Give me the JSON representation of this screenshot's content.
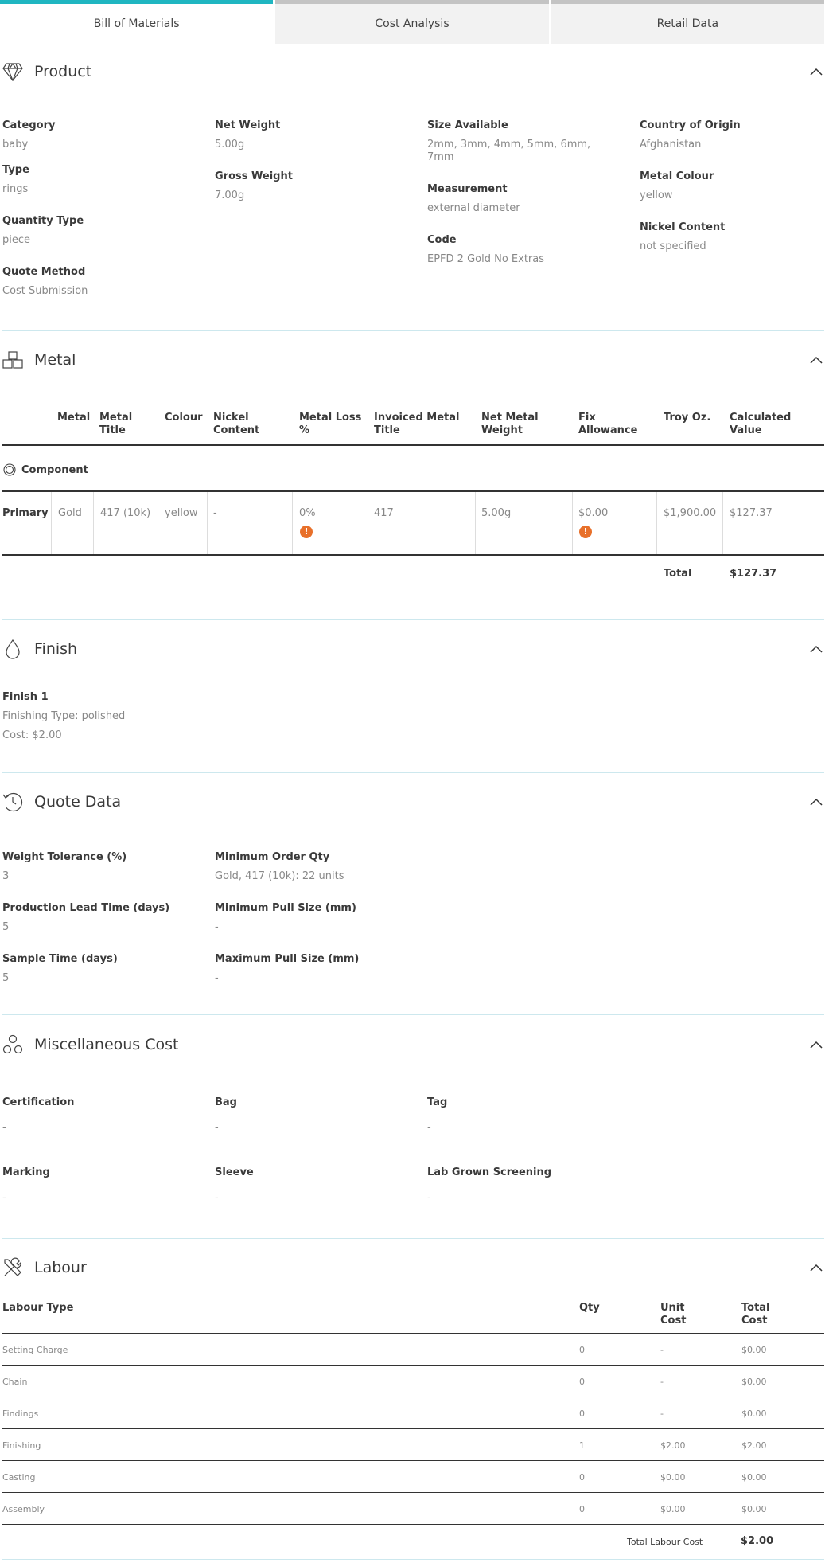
{
  "tabs": [
    {
      "label": "Bill of Materials",
      "active": true
    },
    {
      "label": "Cost Analysis",
      "active": false
    },
    {
      "label": "Retail Data",
      "active": false
    }
  ],
  "product": {
    "title": "Product",
    "category_label": "Category",
    "category": "baby",
    "type_label": "Type",
    "type": "rings",
    "quantity_type_label": "Quantity Type",
    "quantity_type": "piece",
    "quote_method_label": "Quote Method",
    "quote_method": "Cost Submission",
    "net_weight_label": "Net Weight",
    "net_weight": "5.00g",
    "gross_weight_label": "Gross Weight",
    "gross_weight": "7.00g",
    "size_label": "Size Available",
    "size_line1": "2mm, 3mm, 4mm, 5mm, 6mm,",
    "size_line2": "7mm",
    "measurement_label": "Measurement",
    "measurement": "external diameter",
    "code_label": "Code",
    "code": "EPFD 2 Gold No Extras",
    "origin_label": "Country of Origin",
    "origin": "Afghanistan",
    "metal_colour_label": "Metal Colour",
    "metal_colour": "yellow",
    "nickel_label": "Nickel Content",
    "nickel": "not specified"
  },
  "metal": {
    "title": "Metal",
    "headers": {
      "metal": "Metal",
      "metal_title_1": "Metal",
      "metal_title_2": "Title",
      "colour": "Colour",
      "nickel_1": "Nickel",
      "nickel_2": "Content",
      "loss_1": "Metal Loss",
      "loss_2": "%",
      "invoiced_1": "Invoiced Metal",
      "invoiced_2": "Title",
      "net_1": "Net Metal",
      "net_2": "Weight",
      "fix_1": "Fix",
      "fix_2": "Allowance",
      "troy": "Troy Oz.",
      "calc_1": "Calculated",
      "calc_2": "Value"
    },
    "component_label": "Component",
    "row": {
      "name": "Primary",
      "metal": "Gold",
      "title": "417 (10k)",
      "colour": "yellow",
      "nickel": "-",
      "loss": "0%",
      "invoiced": "417",
      "net": "5.00g",
      "fix": "$0.00",
      "troy": "$1,900.00",
      "value": "$127.37"
    },
    "warn_glyph": "!",
    "total_label": "Total",
    "total": "$127.37"
  },
  "finish": {
    "title": "Finish",
    "name": "Finish 1",
    "type": "Finishing Type: polished",
    "cost": "Cost: $2.00"
  },
  "quote": {
    "title": "Quote Data",
    "tolerance_label": "Weight Tolerance (%)",
    "tolerance": "3",
    "lead_label": "Production Lead Time (days)",
    "lead": "5",
    "sample_label": "Sample Time (days)",
    "sample": "5",
    "moq_label": "Minimum Order Qty",
    "moq": "Gold, 417 (10k): 22 units",
    "min_pull_label": "Minimum Pull Size (mm)",
    "min_pull": "-",
    "max_pull_label": "Maximum Pull Size (mm)",
    "max_pull": "-"
  },
  "misc": {
    "title": "Miscellaneous Cost",
    "cert_label": "Certification",
    "cert": "-",
    "bag_label": "Bag",
    "bag": "-",
    "tag_label": "Tag",
    "tag": "-",
    "marking_label": "Marking",
    "marking": "-",
    "sleeve_label": "Sleeve",
    "sleeve": "-",
    "lab_label": "Lab Grown Screening",
    "lab": "-"
  },
  "labour": {
    "title": "Labour",
    "h_type": "Labour Type",
    "h_qty": "Qty",
    "h_unit_1": "Unit",
    "h_unit_2": "Cost",
    "h_total_1": "Total",
    "h_total_2": "Cost",
    "rows": [
      {
        "type": "Setting Charge",
        "qty": "0",
        "unit": "-",
        "total": "$0.00"
      },
      {
        "type": "Chain",
        "qty": "0",
        "unit": "-",
        "total": "$0.00"
      },
      {
        "type": "Findings",
        "qty": "0",
        "unit": "-",
        "total": "$0.00"
      },
      {
        "type": "Finishing",
        "qty": "1",
        "unit": "$2.00",
        "total": "$2.00"
      },
      {
        "type": "Casting",
        "qty": "0",
        "unit": "$0.00",
        "total": "$0.00"
      },
      {
        "type": "Assembly",
        "qty": "0",
        "unit": "$0.00",
        "total": "$0.00"
      }
    ],
    "total_label": "Total Labour Cost",
    "total": "$2.00"
  },
  "colors": {
    "accent": "#1fb6c1",
    "warning": "#e8702a",
    "divider": "#cde8ee"
  }
}
